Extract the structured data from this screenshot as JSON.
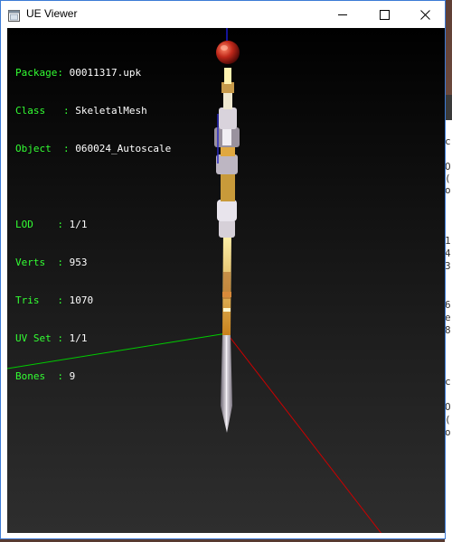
{
  "window": {
    "title": "UE Viewer",
    "controls": {
      "minimize": "minimize",
      "maximize": "maximize",
      "close": "close"
    }
  },
  "info": {
    "package": {
      "label": "Package",
      "value": "00011317.upk"
    },
    "class": {
      "label": "Class",
      "value": "SkeletalMesh"
    },
    "object": {
      "label": "Object",
      "value": "060024_Autoscale"
    },
    "lod": {
      "label": "LOD",
      "value": "1/1"
    },
    "verts": {
      "label": "Verts",
      "value": "953"
    },
    "tris": {
      "label": "Tris",
      "value": "1070"
    },
    "uv_set": {
      "label": "UV Set",
      "value": "1/1"
    },
    "bones": {
      "label": "Bones",
      "value": "9"
    }
  },
  "background_window_text": [
    "c",
    "O",
    "(",
    "o",
    "1",
    "4",
    "3",
    "6",
    "e",
    "8",
    "c",
    "O",
    "(",
    "o"
  ],
  "colors": {
    "info_label": "#33ff33",
    "info_value": "#ffffff",
    "axis_x": "#cc0000",
    "axis_y": "#00cc00",
    "axis_z": "#0000cc",
    "window_border": "#3c7bd6"
  },
  "icons": {
    "app": "window-icon",
    "minimize": "minimize-icon",
    "maximize": "maximize-icon",
    "close": "close-icon"
  }
}
